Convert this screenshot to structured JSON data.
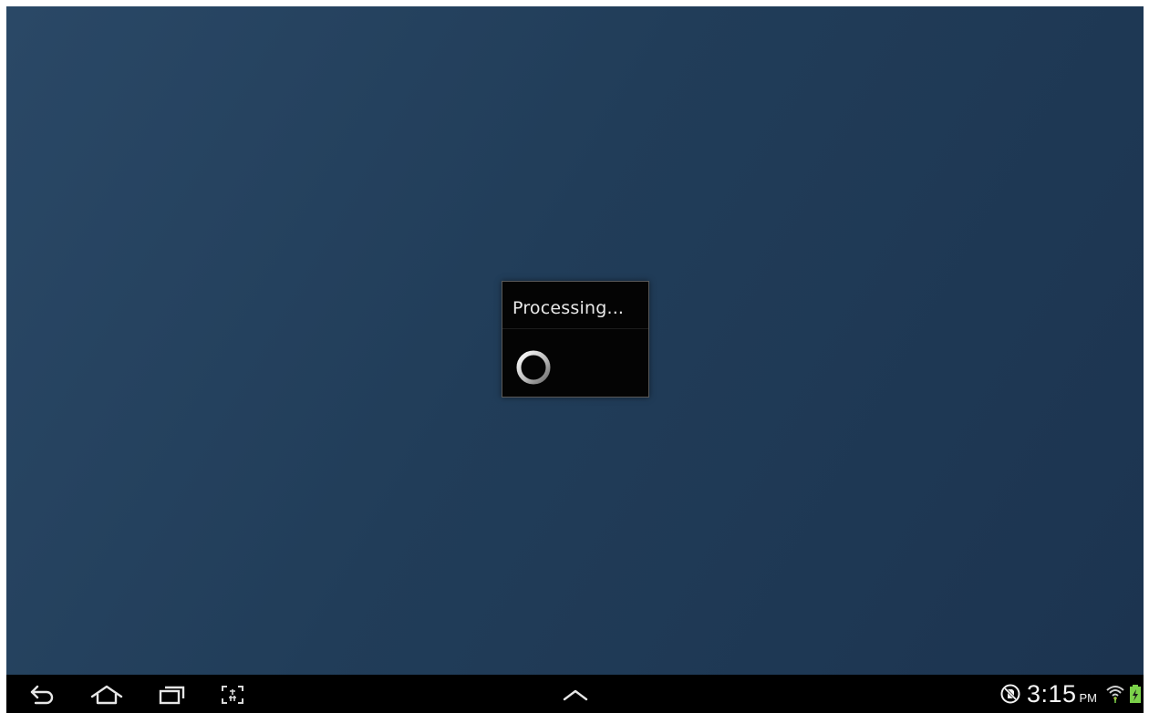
{
  "dialog": {
    "title": "Processing..."
  },
  "status_bar": {
    "time": "3:15",
    "ampm": "PM",
    "icons": [
      "no-sim-icon",
      "wifi-icon",
      "battery-charging-icon"
    ]
  },
  "nav_bar": {
    "buttons": [
      "back-icon",
      "home-icon",
      "recent-apps-icon",
      "screenshot-icon"
    ],
    "center": "chevron-up-icon"
  },
  "colors": {
    "background": "#223f5c",
    "dialog": "#040404",
    "battery": "#7bd14a"
  }
}
